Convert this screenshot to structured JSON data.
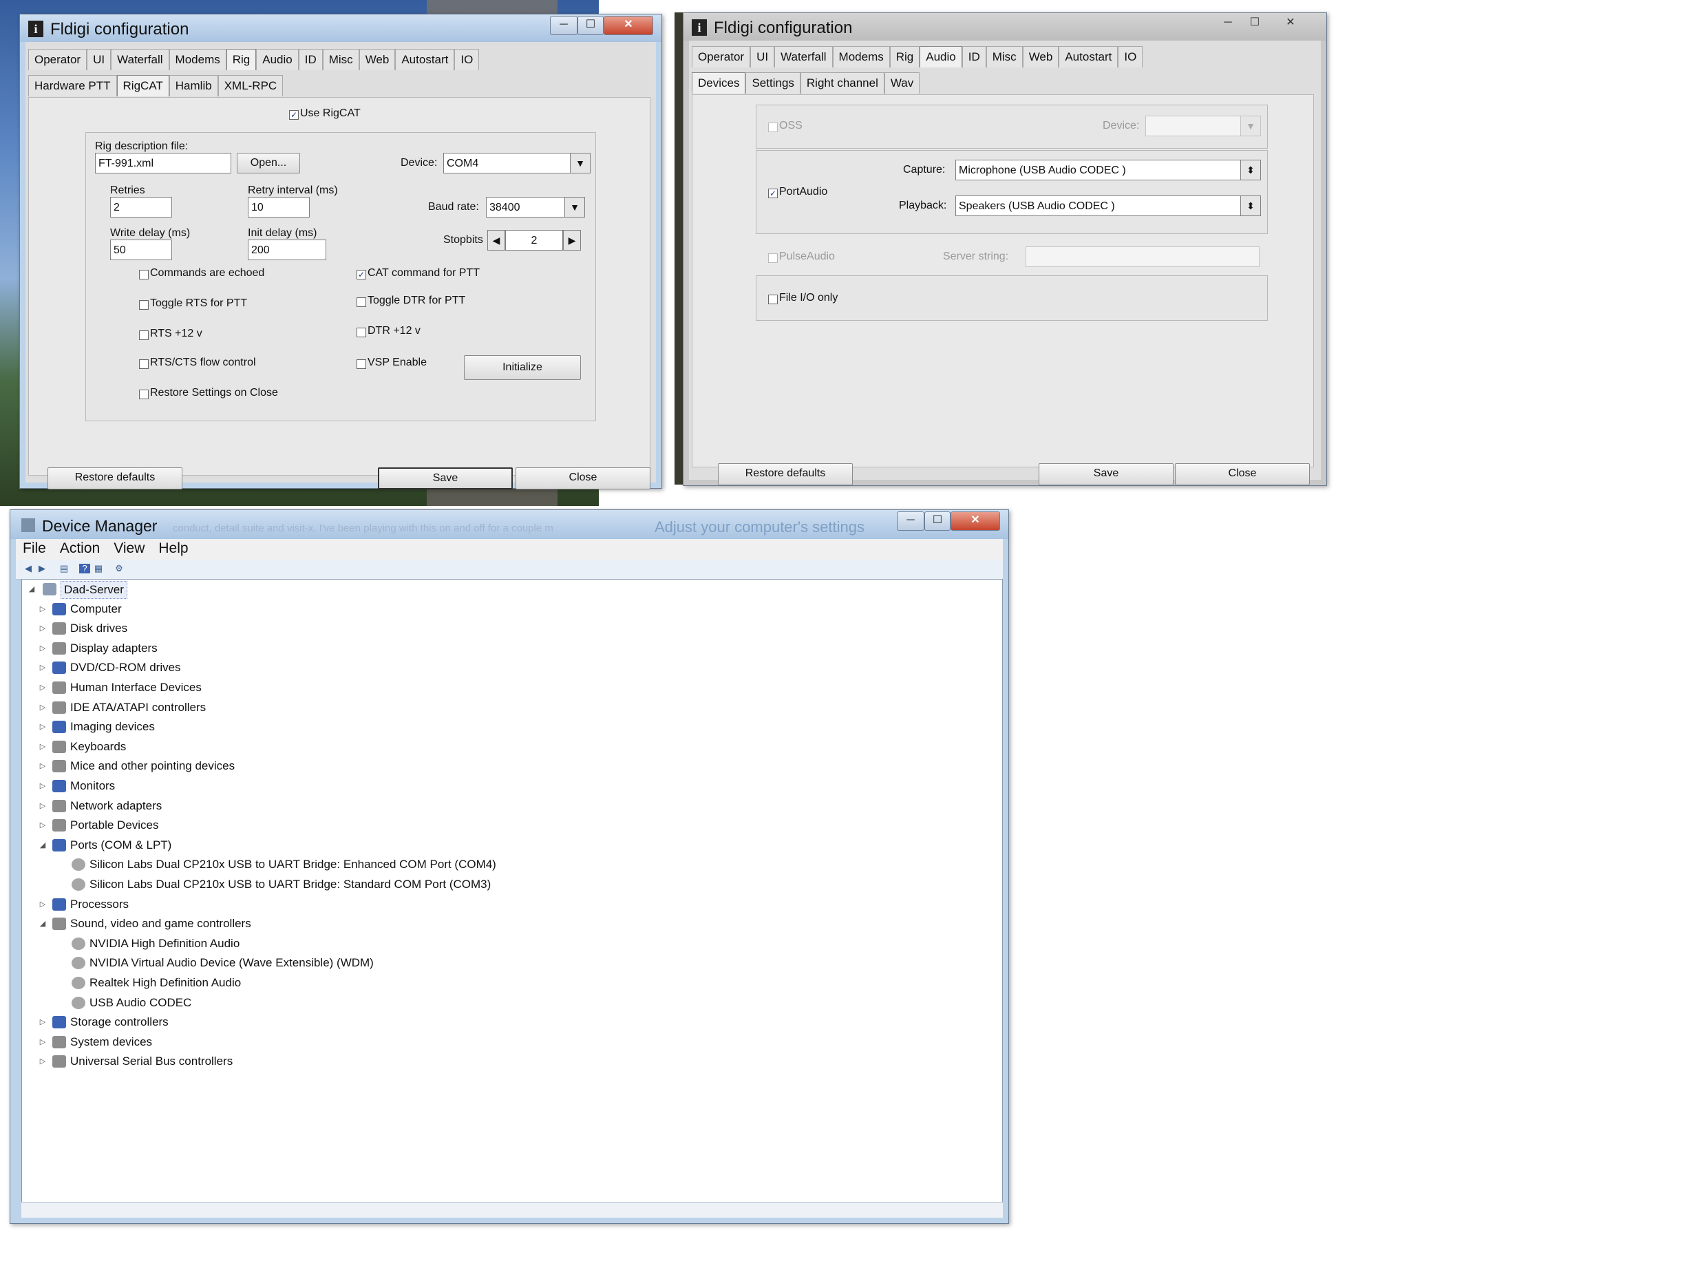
{
  "rigcat_window": {
    "title": "Fldigi configuration",
    "tabs": [
      "Operator",
      "UI",
      "Waterfall",
      "Modems",
      "Rig",
      "Audio",
      "ID",
      "Misc",
      "Web",
      "Autostart",
      "IO"
    ],
    "subtabs": [
      "Hardware PTT",
      "RigCAT",
      "Hamlib",
      "XML-RPC"
    ],
    "use_rigcat": "Use RigCAT",
    "rig_desc_label": "Rig description file:",
    "rig_desc_value": "FT-991.xml",
    "open_button": "Open...",
    "device_label": "Device:",
    "device_value": "COM4",
    "retries_label": "Retries",
    "retries_value": "2",
    "retry_interval_label": "Retry interval (ms)",
    "retry_interval_value": "10",
    "baud_label": "Baud rate:",
    "baud_value": "38400",
    "write_delay_label": "Write delay (ms)",
    "write_delay_value": "50",
    "init_delay_label": "Init delay (ms)",
    "init_delay_value": "200",
    "stopbits_label": "Stopbits",
    "stopbits_value": "2",
    "checks": {
      "commands_echoed": "Commands are echoed",
      "cat_ptt": "CAT command for PTT",
      "toggle_rts": "Toggle RTS for PTT",
      "toggle_dtr": "Toggle DTR for PTT",
      "rts12": "RTS +12 v",
      "dtr12": "DTR +12 v",
      "rtscts": "RTS/CTS flow control",
      "vsp": "VSP Enable",
      "restore": "Restore Settings on Close"
    },
    "initialize_button": "Initialize",
    "restore_defaults": "Restore defaults",
    "save": "Save",
    "close": "Close"
  },
  "audio_window": {
    "title": "Fldigi configuration",
    "tabs": [
      "Operator",
      "UI",
      "Waterfall",
      "Modems",
      "Rig",
      "Audio",
      "ID",
      "Misc",
      "Web",
      "Autostart",
      "IO"
    ],
    "subtabs": [
      "Devices",
      "Settings",
      "Right channel",
      "Wav"
    ],
    "oss": "OSS",
    "device_label": "Device:",
    "portaudio": "PortAudio",
    "capture_label": "Capture:",
    "capture_value": "Microphone (USB Audio CODEC )",
    "playback_label": "Playback:",
    "playback_value": "Speakers (USB Audio CODEC )",
    "pulseaudio": "PulseAudio",
    "server_label": "Server string:",
    "file_io": "File I/O only",
    "restore_defaults": "Restore defaults",
    "save": "Save",
    "close": "Close"
  },
  "device_manager": {
    "title": "Device Manager",
    "bg_text_1": "conduct, detail suite and visit-x.   I've been playing with this on and off for a couple m",
    "bg_text_2": "Adjust your computer's settings",
    "menu": [
      "File",
      "Action",
      "View",
      "Help"
    ],
    "root": "Dad-Server",
    "tree": [
      {
        "label": "Computer",
        "level": 1,
        "exp": "closed"
      },
      {
        "label": "Disk drives",
        "level": 1,
        "exp": "closed"
      },
      {
        "label": "Display adapters",
        "level": 1,
        "exp": "closed"
      },
      {
        "label": "DVD/CD-ROM drives",
        "level": 1,
        "exp": "closed"
      },
      {
        "label": "Human Interface Devices",
        "level": 1,
        "exp": "closed"
      },
      {
        "label": "IDE ATA/ATAPI controllers",
        "level": 1,
        "exp": "closed"
      },
      {
        "label": "Imaging devices",
        "level": 1,
        "exp": "closed"
      },
      {
        "label": "Keyboards",
        "level": 1,
        "exp": "closed"
      },
      {
        "label": "Mice and other pointing devices",
        "level": 1,
        "exp": "closed"
      },
      {
        "label": "Monitors",
        "level": 1,
        "exp": "closed"
      },
      {
        "label": "Network adapters",
        "level": 1,
        "exp": "closed"
      },
      {
        "label": "Portable Devices",
        "level": 1,
        "exp": "closed"
      },
      {
        "label": "Ports (COM & LPT)",
        "level": 1,
        "exp": "open"
      },
      {
        "label": "Silicon Labs Dual CP210x USB to UART Bridge: Enhanced COM Port (COM4)",
        "level": 2,
        "exp": "none"
      },
      {
        "label": "Silicon Labs Dual CP210x USB to UART Bridge: Standard COM Port (COM3)",
        "level": 2,
        "exp": "none"
      },
      {
        "label": "Processors",
        "level": 1,
        "exp": "closed"
      },
      {
        "label": "Sound, video and game controllers",
        "level": 1,
        "exp": "open"
      },
      {
        "label": "NVIDIA High Definition Audio",
        "level": 2,
        "exp": "none"
      },
      {
        "label": "NVIDIA Virtual Audio Device (Wave Extensible) (WDM)",
        "level": 2,
        "exp": "none"
      },
      {
        "label": "Realtek High Definition Audio",
        "level": 2,
        "exp": "none"
      },
      {
        "label": "USB Audio CODEC",
        "level": 2,
        "exp": "none"
      },
      {
        "label": "Storage controllers",
        "level": 1,
        "exp": "closed"
      },
      {
        "label": "System devices",
        "level": 1,
        "exp": "closed"
      },
      {
        "label": "Universal Serial Bus controllers",
        "level": 1,
        "exp": "closed"
      }
    ]
  },
  "colors": {
    "icon_blue": "#3d64b4",
    "icon_gray": "#8c8c8c",
    "title_bar": "#a9c4e2"
  },
  "icons": {
    "minimize": "─",
    "maximize": "☐",
    "close": "✕",
    "check": "✓",
    "arrow_down": "▼",
    "arrow_left": "◀",
    "arrow_right": "▶",
    "spin": "⬍",
    "tree_closed": "▷",
    "tree_open": "◢"
  }
}
